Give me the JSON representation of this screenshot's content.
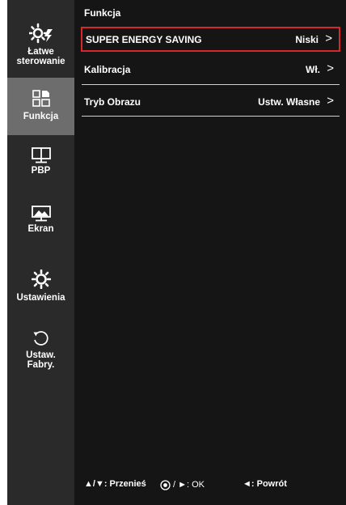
{
  "sidebar": {
    "items": [
      {
        "label": "Łatwe sterowanie",
        "icon": "easy-control-icon"
      },
      {
        "label": "Funkcja",
        "icon": "function-icon",
        "active": true
      },
      {
        "label": "PBP",
        "icon": "pbp-icon"
      },
      {
        "label": "Ekran",
        "icon": "screen-icon"
      },
      {
        "label": "Ustawienia",
        "icon": "settings-icon"
      },
      {
        "label": "Ustaw. Fabry.",
        "icon": "factory-reset-icon"
      }
    ]
  },
  "main": {
    "title": "Funkcja",
    "rows": [
      {
        "label": "SUPER ENERGY SAVING",
        "value": "Niski",
        "chevron": ">"
      },
      {
        "label": "Kalibracja",
        "value": "Wł.",
        "chevron": ">"
      },
      {
        "label": "Tryb Obrazu",
        "value": "Ustw. Własne",
        "chevron": ">"
      }
    ]
  },
  "footer": {
    "move": "▲/▼: Przenieś",
    "ok": "/ ►: OK",
    "back": "◄: Powrót"
  },
  "colors": {
    "sidebar_bg": "#2a2a2a",
    "active_bg": "#6d6d6d",
    "main_bg": "#151515",
    "highlight": "#d7262c"
  }
}
